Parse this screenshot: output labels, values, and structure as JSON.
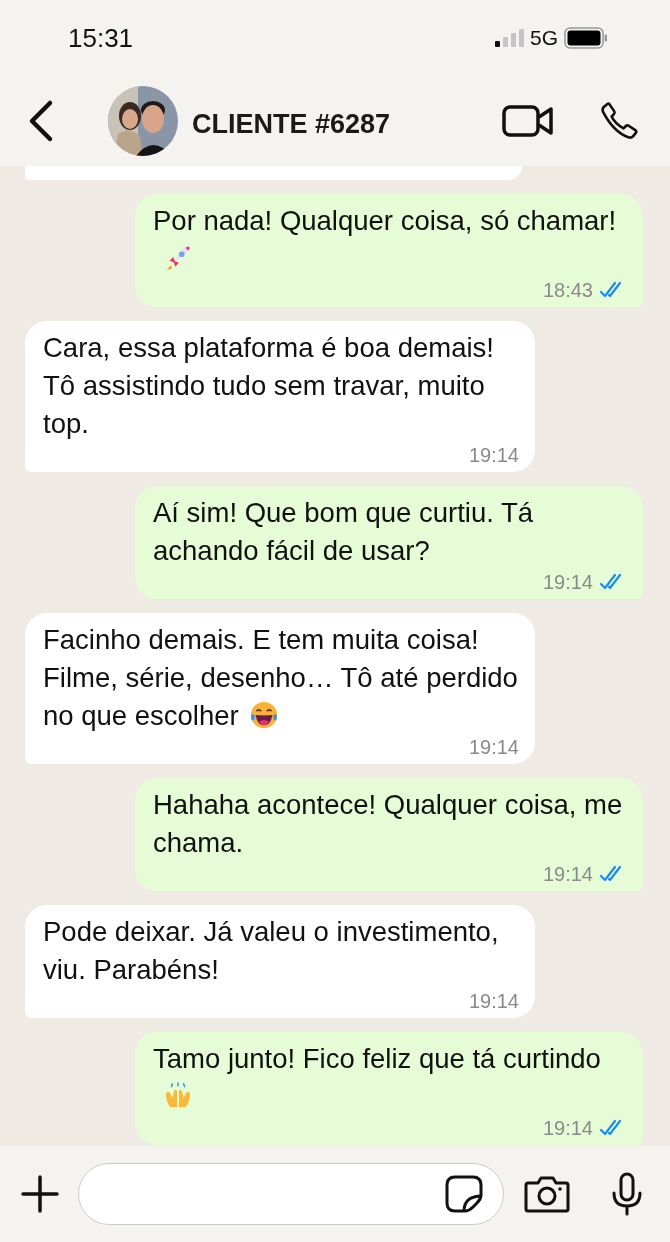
{
  "status_bar": {
    "time": "15:31",
    "network": "5G"
  },
  "header": {
    "title": "CLIENTE #6287"
  },
  "messages": [
    {
      "outgoing": false,
      "partial": true
    },
    {
      "outgoing": true,
      "text": "Por nada! Qualquer coisa, só chamar!",
      "emoji": {
        "kind": "rocket"
      },
      "time": "18:43",
      "read": true
    },
    {
      "outgoing": false,
      "text": "Cara, essa plataforma é boa demais! Tô assistindo tudo sem travar, muito top.",
      "time": "19:14"
    },
    {
      "outgoing": true,
      "text": "Aí sim! Que bom que curtiu. Tá achando fácil de usar?",
      "time": "19:14",
      "read": true
    },
    {
      "outgoing": false,
      "text": "Facinho demais. E tem muita coisa! Filme, série, desenho… Tô até perdido no que escolher",
      "emoji": {
        "kind": "laughing"
      },
      "time": "19:14"
    },
    {
      "outgoing": true,
      "text": "Hahaha acontece! Qualquer coisa, me chama.",
      "time": "19:14",
      "read": true
    },
    {
      "outgoing": false,
      "text": "Pode deixar. Já valeu o investimento, viu. Parabéns!",
      "time": "19:14"
    },
    {
      "outgoing": true,
      "text": "Tamo junto! Fico feliz que tá curtindo",
      "emoji": {
        "kind": "raised-hands"
      },
      "time": "19:14",
      "read": true
    }
  ]
}
